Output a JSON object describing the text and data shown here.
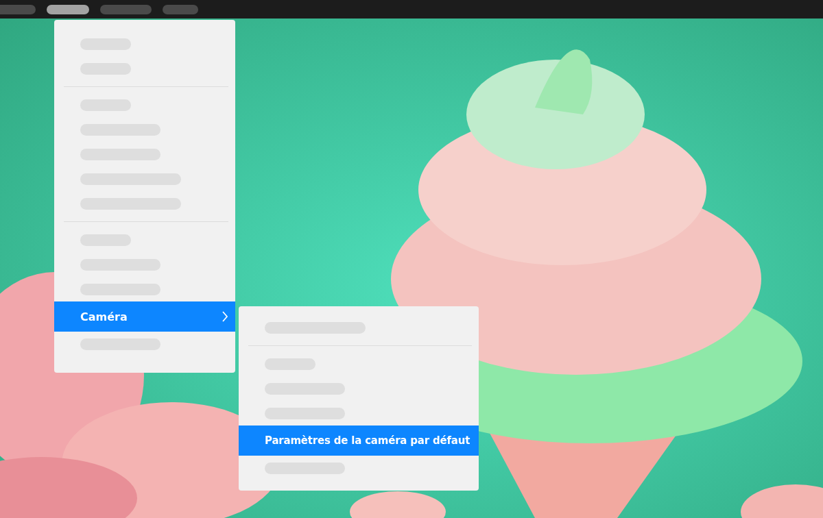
{
  "menu_bar": [
    {
      "kind": "medium",
      "selected": false
    },
    {
      "kind": "medium",
      "selected": true
    },
    {
      "kind": "long",
      "selected": false
    },
    {
      "kind": "short",
      "selected": false
    }
  ],
  "menu": {
    "items": [
      {
        "kind": "short",
        "selected": false
      },
      {
        "kind": "short",
        "selected": false
      },
      {
        "kind": "separator"
      },
      {
        "kind": "short",
        "selected": false
      },
      {
        "kind": "medium",
        "selected": false
      },
      {
        "kind": "medium",
        "selected": false
      },
      {
        "kind": "long",
        "selected": false
      },
      {
        "kind": "long",
        "selected": false
      },
      {
        "kind": "separator"
      },
      {
        "kind": "short",
        "selected": false
      },
      {
        "kind": "medium",
        "selected": false
      },
      {
        "kind": "medium",
        "selected": false
      },
      {
        "kind": "item",
        "label": "Caméra",
        "selected": true,
        "has_submenu": true
      },
      {
        "kind": "medium",
        "selected": false
      }
    ]
  },
  "submenu": {
    "items": [
      {
        "kind": "long",
        "selected": false
      },
      {
        "kind": "separator"
      },
      {
        "kind": "short",
        "selected": false
      },
      {
        "kind": "medium",
        "selected": false
      },
      {
        "kind": "medium",
        "selected": false
      },
      {
        "kind": "item",
        "label": "Paramètres de la caméra par défaut",
        "selected": true,
        "has_submenu": false
      },
      {
        "kind": "medium",
        "selected": false
      }
    ]
  }
}
